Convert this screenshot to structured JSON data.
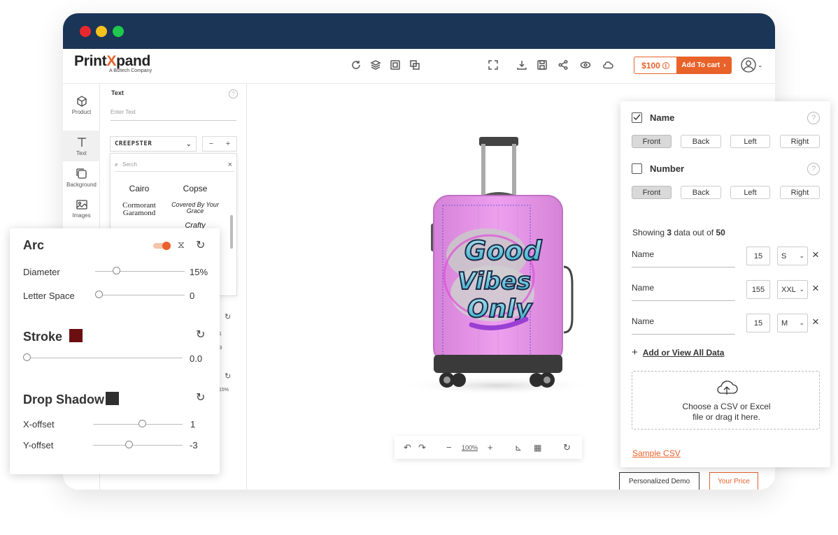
{
  "window": {
    "dot_colors": [
      "#e8282e",
      "#f5c11d",
      "#1fc94c"
    ]
  },
  "brand": {
    "name_part1": "Print",
    "name_x": "X",
    "name_part2": "pand",
    "tagline": "A Biztech Company",
    "accent": "#e8622a"
  },
  "toolbar": {
    "left_icons": [
      "refresh-icon",
      "layers-icon",
      "preview-icon",
      "copy-icon"
    ],
    "right_icons": [
      "fullscreen-icon",
      "download-icon",
      "save-icon",
      "share-icon",
      "view-3d-icon",
      "cloud-icon"
    ],
    "price": "$100",
    "add_to_cart": "Add To cart"
  },
  "sidebar": {
    "items": [
      {
        "label": "Product",
        "icon": "cube-icon"
      },
      {
        "label": "Text",
        "icon": "text-icon"
      },
      {
        "label": "Background",
        "icon": "background-icon"
      },
      {
        "label": "Images",
        "icon": "image-icon"
      }
    ]
  },
  "text_panel": {
    "title": "Text",
    "placeholder": "Enter Text",
    "font_selected": "CREEPSTER",
    "search_placeholder": "Serch",
    "fonts": [
      "Cairo",
      "Copse",
      "Cormorant Garamond",
      "Covered By Your Grace",
      "Crafty"
    ],
    "partial_values": [
      "1",
      "-3",
      "15%"
    ]
  },
  "arc_panel": {
    "arc_title": "Arc",
    "diameter_label": "Diameter",
    "diameter_value": "15%",
    "letter_space_label": "Letter Space",
    "letter_space_value": "0",
    "stroke_title": "Stroke",
    "stroke_color": "#6b0f12",
    "stroke_value": "0.0",
    "shadow_title": "Drop Shadow",
    "shadow_color": "#2f2f2f",
    "x_offset_label": "X-offset",
    "x_offset_value": "1",
    "y_offset_label": "Y-offset",
    "y_offset_value": "-3"
  },
  "canvas": {
    "zoom": "100%",
    "design_text": [
      "Good",
      "Vibes",
      "Only"
    ],
    "bottom_buttons": [
      "Personalized Demo",
      "Your Price"
    ]
  },
  "personalize": {
    "name_label": "Name",
    "number_label": "Number",
    "sides": [
      "Front",
      "Back",
      "Left",
      "Right"
    ],
    "showing_prefix": "Showing ",
    "showing_count": "3",
    "showing_mid": " data out of ",
    "showing_total": "50",
    "rows": [
      {
        "name": "Name",
        "number": "15",
        "size": "S"
      },
      {
        "name": "Name",
        "number": "155",
        "size": "XXL"
      },
      {
        "name": "Name",
        "number": "15",
        "size": "M"
      }
    ],
    "add_view": "Add or View All Data",
    "upload_line1": "Choose a CSV or Excel",
    "upload_line2": "file or drag it here.",
    "sample_csv": "Sample CSV"
  }
}
